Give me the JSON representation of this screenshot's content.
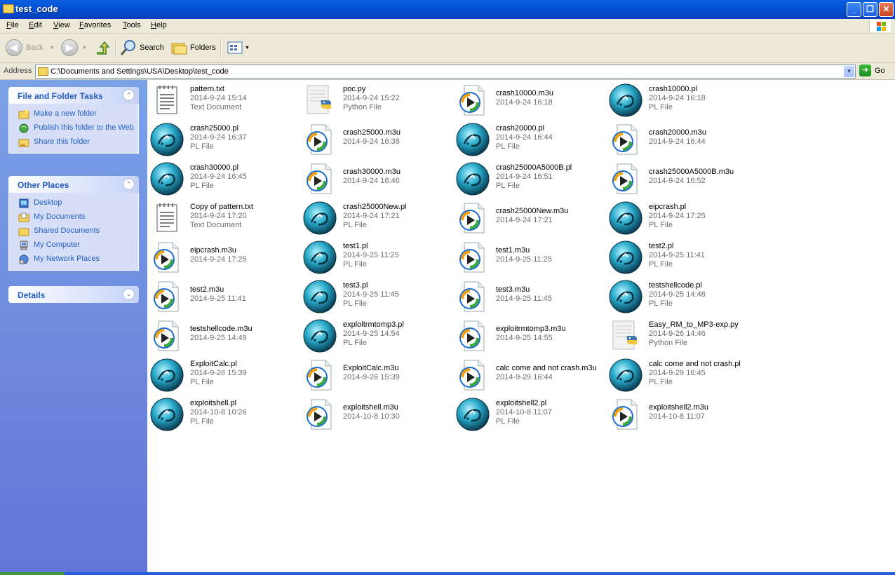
{
  "window": {
    "title": "test_code"
  },
  "menu": [
    "File",
    "Edit",
    "View",
    "Favorites",
    "Tools",
    "Help"
  ],
  "toolbar": {
    "back": "Back",
    "search": "Search",
    "folders": "Folders"
  },
  "address": {
    "label": "Address",
    "path": "C:\\Documents and Settings\\USA\\Desktop\\test_code",
    "go": "Go"
  },
  "tasks": {
    "title": "File and Folder Tasks",
    "items": [
      "Make a new folder",
      "Publish this folder to the Web",
      "Share this folder"
    ]
  },
  "places": {
    "title": "Other Places",
    "items": [
      "Desktop",
      "My Documents",
      "Shared Documents",
      "My Computer",
      "My Network Places"
    ]
  },
  "details": {
    "title": "Details"
  },
  "files": [
    {
      "name": "pattern.txt",
      "date": "2014-9-24 15:14",
      "type": "Text Document",
      "icon": "text-document-icon"
    },
    {
      "name": "poc.py",
      "date": "2014-9-24 15:22",
      "type": "Python File",
      "icon": "python-file-icon"
    },
    {
      "name": "crash10000.m3u",
      "date": "2014-9-24 16:18",
      "type": "",
      "icon": "media-playlist-icon"
    },
    {
      "name": "crash10000.pl",
      "date": "2014-9-24 16:18",
      "type": "PL File",
      "icon": "perl-file-icon"
    },
    {
      "name": "crash25000.pl",
      "date": "2014-9-24 16:37",
      "type": "PL File",
      "icon": "perl-file-icon"
    },
    {
      "name": "crash25000.m3u",
      "date": "2014-9-24 16:38",
      "type": "",
      "icon": "media-playlist-icon"
    },
    {
      "name": "crash20000.pl",
      "date": "2014-9-24 16:44",
      "type": "PL File",
      "icon": "perl-file-icon"
    },
    {
      "name": "crash20000.m3u",
      "date": "2014-9-24 16:44",
      "type": "",
      "icon": "media-playlist-icon"
    },
    {
      "name": "crash30000.pl",
      "date": "2014-9-24 16:45",
      "type": "PL File",
      "icon": "perl-file-icon"
    },
    {
      "name": "crash30000.m3u",
      "date": "2014-9-24 16:46",
      "type": "",
      "icon": "media-playlist-icon"
    },
    {
      "name": "crash25000A5000B.pl",
      "date": "2014-9-24 16:51",
      "type": "PL File",
      "icon": "perl-file-icon"
    },
    {
      "name": "crash25000A5000B.m3u",
      "date": "2014-9-24 16:52",
      "type": "",
      "icon": "media-playlist-icon"
    },
    {
      "name": "Copy of pattern.txt",
      "date": "2014-9-24 17:20",
      "type": "Text Document",
      "icon": "text-document-icon"
    },
    {
      "name": "crash25000New.pl",
      "date": "2014-9-24 17:21",
      "type": "PL File",
      "icon": "perl-file-icon"
    },
    {
      "name": "crash25000New.m3u",
      "date": "2014-9-24 17:21",
      "type": "",
      "icon": "media-playlist-icon"
    },
    {
      "name": "eipcrash.pl",
      "date": "2014-9-24 17:25",
      "type": "PL File",
      "icon": "perl-file-icon"
    },
    {
      "name": "eipcrash.m3u",
      "date": "2014-9-24 17:25",
      "type": "",
      "icon": "media-playlist-icon"
    },
    {
      "name": "test1.pl",
      "date": "2014-9-25 11:25",
      "type": "PL File",
      "icon": "perl-file-icon"
    },
    {
      "name": "test1.m3u",
      "date": "2014-9-25 11:25",
      "type": "",
      "icon": "media-playlist-icon"
    },
    {
      "name": "test2.pl",
      "date": "2014-9-25 11:41",
      "type": "PL File",
      "icon": "perl-file-icon"
    },
    {
      "name": "test2.m3u",
      "date": "2014-9-25 11:41",
      "type": "",
      "icon": "media-playlist-icon"
    },
    {
      "name": "test3.pl",
      "date": "2014-9-25 11:45",
      "type": "PL File",
      "icon": "perl-file-icon"
    },
    {
      "name": "test3.m3u",
      "date": "2014-9-25 11:45",
      "type": "",
      "icon": "media-playlist-icon"
    },
    {
      "name": "testshellcode.pl",
      "date": "2014-9-25 14:48",
      "type": "PL File",
      "icon": "perl-file-icon"
    },
    {
      "name": "testshellcode.m3u",
      "date": "2014-9-25 14:49",
      "type": "",
      "icon": "media-playlist-icon"
    },
    {
      "name": "exploitrmtomp3.pl",
      "date": "2014-9-25 14:54",
      "type": "PL File",
      "icon": "perl-file-icon"
    },
    {
      "name": "exploitrmtomp3.m3u",
      "date": "2014-9-25 14:55",
      "type": "",
      "icon": "media-playlist-icon"
    },
    {
      "name": "Easy_RM_to_MP3-exp.py",
      "date": "2014-9-26 14:46",
      "type": "Python File",
      "icon": "python-file-icon"
    },
    {
      "name": "ExploitCalc.pl",
      "date": "2014-9-26 15:39",
      "type": "PL File",
      "icon": "perl-file-icon"
    },
    {
      "name": "ExploitCalc.m3u",
      "date": "2014-9-26 15:39",
      "type": "",
      "icon": "media-playlist-icon"
    },
    {
      "name": "calc come and not crash.m3u",
      "date": "2014-9-29 16:44",
      "type": "",
      "icon": "media-playlist-icon"
    },
    {
      "name": "calc come and not crash.pl",
      "date": "2014-9-29 16:45",
      "type": "PL File",
      "icon": "perl-file-icon"
    },
    {
      "name": "exploitshell.pl",
      "date": "2014-10-8 10:26",
      "type": "PL File",
      "icon": "perl-file-icon"
    },
    {
      "name": "exploitshell.m3u",
      "date": "2014-10-8 10:30",
      "type": "",
      "icon": "media-playlist-icon"
    },
    {
      "name": "exploitshell2.pl",
      "date": "2014-10-8 11:07",
      "type": "PL File",
      "icon": "perl-file-icon"
    },
    {
      "name": "exploitshell2.m3u",
      "date": "2014-10-8 11:07",
      "type": "",
      "icon": "media-playlist-icon"
    }
  ]
}
